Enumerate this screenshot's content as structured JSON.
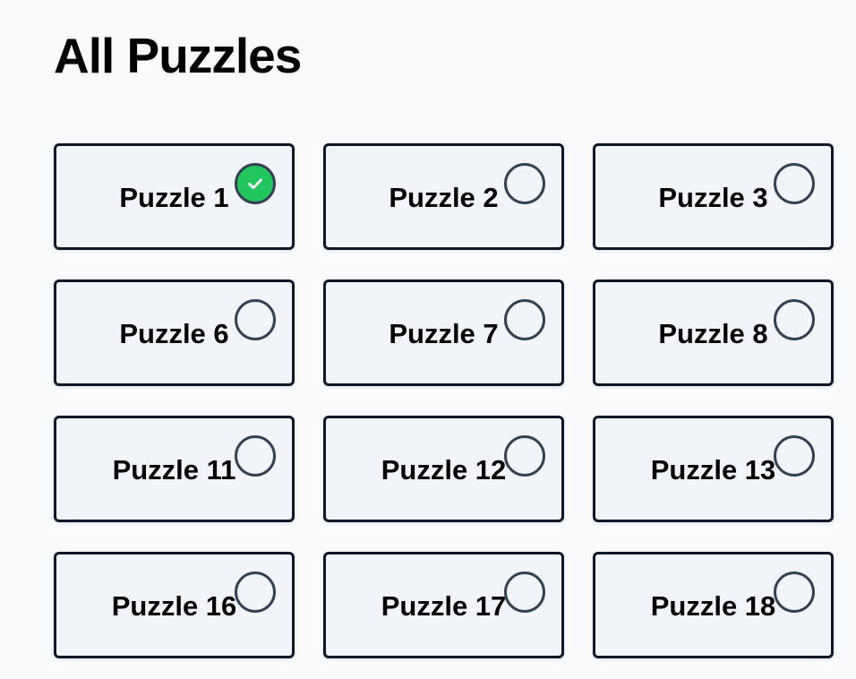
{
  "page": {
    "title": "All Puzzles"
  },
  "colors": {
    "background": "#f8fafc",
    "card_background": "#f1f5f9",
    "card_border": "#0f172a",
    "status_ring": "#334155",
    "completed_fill": "#22c55e",
    "check_mark": "#ffffff"
  },
  "puzzles": [
    {
      "label": "Puzzle 1",
      "completed": true,
      "status_icon": "check-circle-icon"
    },
    {
      "label": "Puzzle 2",
      "completed": false,
      "status_icon": "empty-circle-icon"
    },
    {
      "label": "Puzzle 3",
      "completed": false,
      "status_icon": "empty-circle-icon"
    },
    {
      "label": "Puzzle 6",
      "completed": false,
      "status_icon": "empty-circle-icon"
    },
    {
      "label": "Puzzle 7",
      "completed": false,
      "status_icon": "empty-circle-icon"
    },
    {
      "label": "Puzzle 8",
      "completed": false,
      "status_icon": "empty-circle-icon"
    },
    {
      "label": "Puzzle 11",
      "completed": false,
      "status_icon": "empty-circle-icon"
    },
    {
      "label": "Puzzle 12",
      "completed": false,
      "status_icon": "empty-circle-icon"
    },
    {
      "label": "Puzzle 13",
      "completed": false,
      "status_icon": "empty-circle-icon"
    },
    {
      "label": "Puzzle 16",
      "completed": false,
      "status_icon": "empty-circle-icon"
    },
    {
      "label": "Puzzle 17",
      "completed": false,
      "status_icon": "empty-circle-icon"
    },
    {
      "label": "Puzzle 18",
      "completed": false,
      "status_icon": "empty-circle-icon"
    }
  ]
}
